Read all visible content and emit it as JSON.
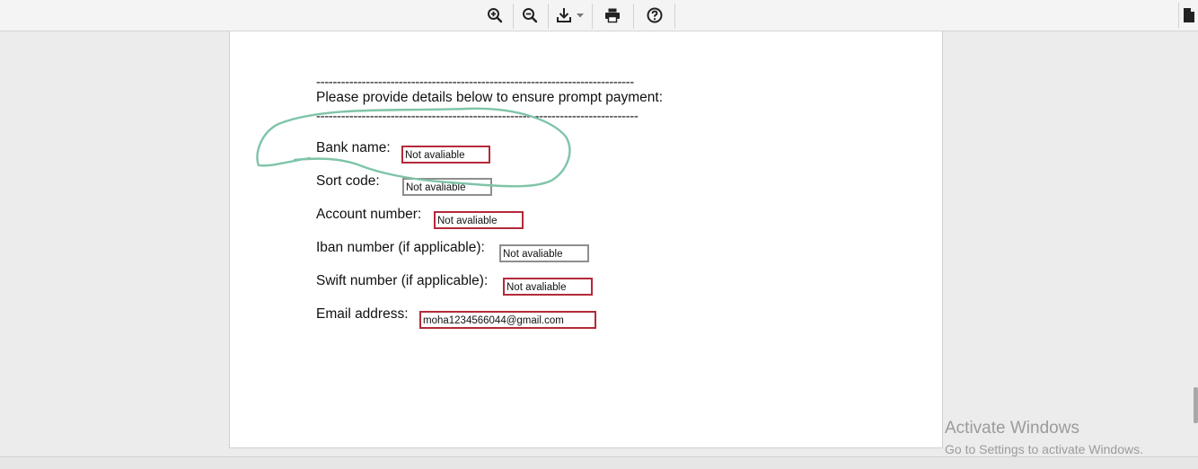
{
  "toolbar": {
    "zoom_in_icon": "zoom-in-icon",
    "zoom_out_icon": "zoom-out-icon",
    "download_icon": "download-icon",
    "print_icon": "print-icon",
    "help_icon": "help-icon",
    "document_icon": "document-icon"
  },
  "document": {
    "dash_line_1": "-----------------------------------------------------------------------------",
    "heading": "Please provide details below to ensure prompt payment:",
    "dash_line_2": "------------------------------------------------------------------------------",
    "fields": [
      {
        "label": "Bank name:",
        "value": "Not avaliable"
      },
      {
        "label": "Sort code:",
        "value": "Not avaliable"
      },
      {
        "label": "Account number:",
        "value": "Not avaliable"
      },
      {
        "label": "Iban number (if applicable):",
        "value": "Not avaliable"
      },
      {
        "label": "Swift number (if applicable):",
        "value": "Not avaliable"
      },
      {
        "label": "Email address:",
        "value": "moha1234566044@gmail.com"
      }
    ],
    "annotation_color": "#7fc4a8"
  },
  "watermark": {
    "title": "Activate Windows",
    "subtitle": "Go to Settings to activate Windows."
  },
  "colors": {
    "field_border_red": "#b42a3a",
    "field_border_gray": "#8e8e8e"
  }
}
